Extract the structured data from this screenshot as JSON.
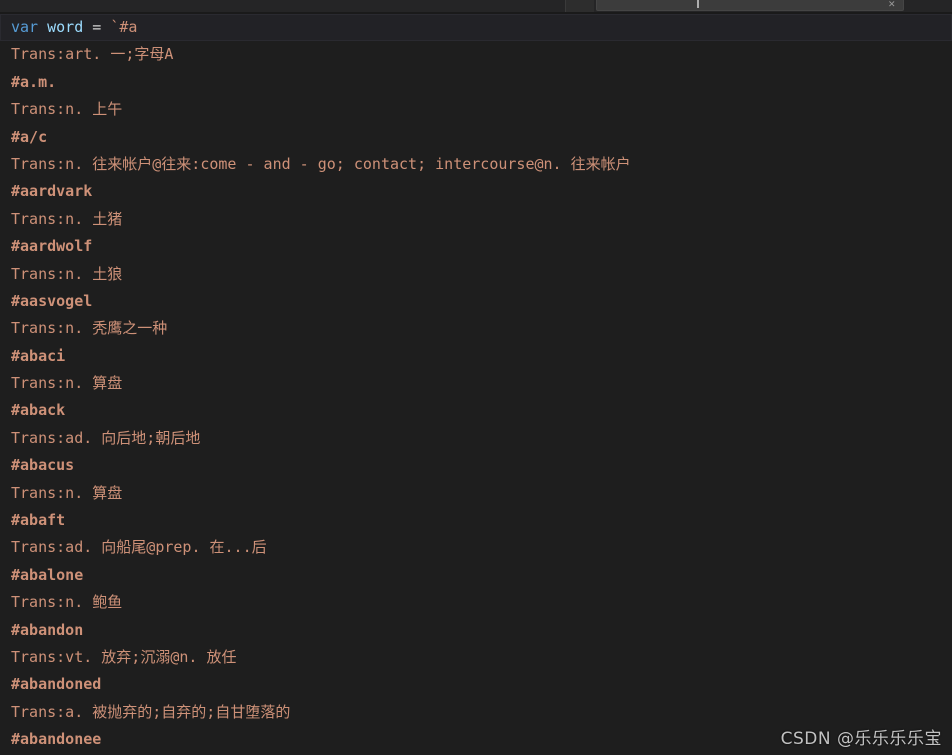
{
  "window": {
    "theme_background": "#1e1e1e",
    "chrome_background": "#252526",
    "find_widget_background": "#3c3c3c",
    "find_widget_value": "",
    "find_widget_right_icon": "✕"
  },
  "editor": {
    "string_color": "#ce9178",
    "keyword_color": "#569cd6",
    "variable_color": "#9cdcfe",
    "operator_color": "#d4d4d4",
    "first_line": {
      "keyword": "var",
      "space1": " ",
      "variable": "word",
      "space2": " ",
      "operator": "=",
      "space3": " ",
      "string": "`#a"
    },
    "lines": [
      {
        "kind": "trans",
        "text": "Trans:art. 一;字母A"
      },
      {
        "kind": "headword",
        "text": "#a.m."
      },
      {
        "kind": "trans",
        "text": "Trans:n. 上午"
      },
      {
        "kind": "headword",
        "text": "#a/c"
      },
      {
        "kind": "trans",
        "text": "Trans:n. 往来帐户@往来:come - and - go; contact; intercourse@n. 往来帐户"
      },
      {
        "kind": "headword",
        "text": "#aardvark"
      },
      {
        "kind": "trans",
        "text": "Trans:n. 土猪"
      },
      {
        "kind": "headword",
        "text": "#aardwolf"
      },
      {
        "kind": "trans",
        "text": "Trans:n. 土狼"
      },
      {
        "kind": "headword",
        "text": "#aasvogel"
      },
      {
        "kind": "trans",
        "text": "Trans:n. 秃鹰之一种"
      },
      {
        "kind": "headword",
        "text": "#abaci"
      },
      {
        "kind": "trans",
        "text": "Trans:n. 算盘"
      },
      {
        "kind": "headword",
        "text": "#aback"
      },
      {
        "kind": "trans",
        "text": "Trans:ad. 向后地;朝后地"
      },
      {
        "kind": "headword",
        "text": "#abacus"
      },
      {
        "kind": "trans",
        "text": "Trans:n. 算盘"
      },
      {
        "kind": "headword",
        "text": "#abaft"
      },
      {
        "kind": "trans",
        "text": "Trans:ad. 向船尾@prep. 在...后"
      },
      {
        "kind": "headword",
        "text": "#abalone"
      },
      {
        "kind": "trans",
        "text": "Trans:n. 鲍鱼"
      },
      {
        "kind": "headword",
        "text": "#abandon"
      },
      {
        "kind": "trans",
        "text": "Trans:vt. 放弃;沉溺@n. 放任"
      },
      {
        "kind": "headword",
        "text": "#abandoned"
      },
      {
        "kind": "trans",
        "text": "Trans:a. 被抛弃的;自弃的;自甘堕落的"
      },
      {
        "kind": "headword",
        "text": "#abandonee"
      }
    ]
  },
  "watermark": {
    "text": "CSDN @乐乐乐乐宝"
  }
}
